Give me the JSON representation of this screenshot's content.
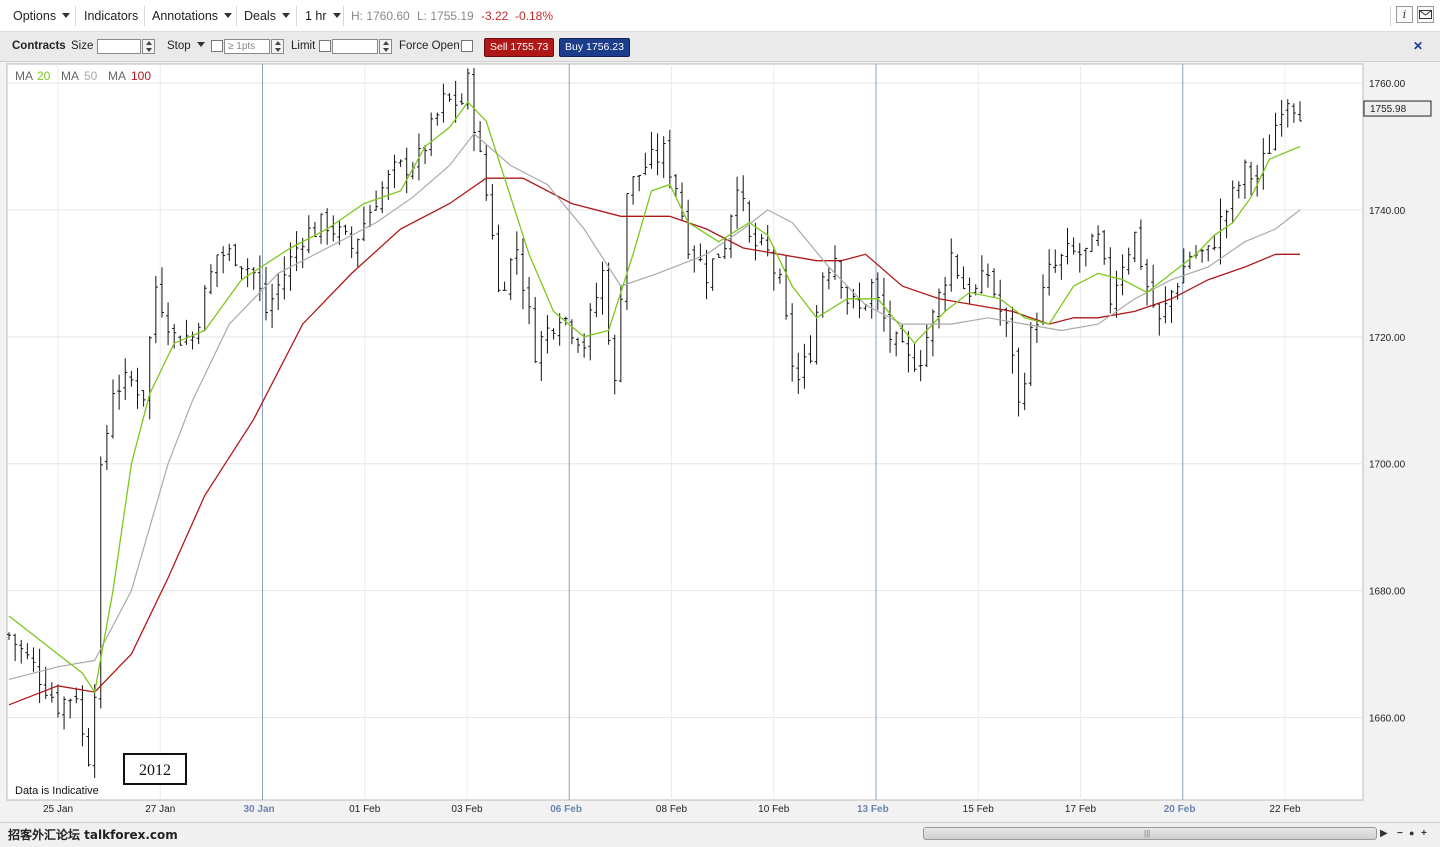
{
  "toolbar": {
    "menus": [
      "Options",
      "Indicators",
      "Annotations",
      "Deals",
      "1 hr"
    ],
    "high": "H: 1760.60",
    "low": "L: 1755.19",
    "change": "-3.22",
    "change_pct": "-0.18%",
    "info_glyph": "i",
    "icons": [
      "info-icon",
      "mail-icon"
    ]
  },
  "trade": {
    "contracts_label": "Contracts",
    "size_label": "Size",
    "size_value": "",
    "stop_label": "Stop",
    "stop_placeholder": "≥ 1pts",
    "limit_label": "Limit",
    "limit_value": "",
    "force_open_label": "Force Open",
    "sell_label": "Sell 1755.73",
    "buy_label": "Buy 1756.23",
    "close_glyph": "✕"
  },
  "legend": [
    {
      "prefix": "MA",
      "period": "20",
      "color": "#7cc81e"
    },
    {
      "prefix": "MA",
      "period": "50",
      "color": "#aaaaaa"
    },
    {
      "prefix": "MA",
      "period": "100",
      "color": "#b01818"
    }
  ],
  "chart_data": {
    "type": "ohlc",
    "y_ticks": [
      1660,
      1680,
      1700,
      1720,
      1740,
      1760
    ],
    "y_tick_labels": [
      "1660.00",
      "1680.00",
      "1700.00",
      "1720.00",
      "1740.00",
      "1760.00"
    ],
    "ylim": [
      1647,
      1763
    ],
    "current_price": 1755.98,
    "current_price_label": "1755.98",
    "x_labels": [
      {
        "text": "25 Jan",
        "week_start": false
      },
      {
        "text": "27 Jan",
        "week_start": false
      },
      {
        "text": "30 Jan",
        "week_start": true
      },
      {
        "text": "01 Feb",
        "week_start": false
      },
      {
        "text": "03 Feb",
        "week_start": false
      },
      {
        "text": "06 Feb",
        "week_start": true
      },
      {
        "text": "08 Feb",
        "week_start": false
      },
      {
        "text": "10 Feb",
        "week_start": false
      },
      {
        "text": "13 Feb",
        "week_start": true
      },
      {
        "text": "15 Feb",
        "week_start": false
      },
      {
        "text": "17 Feb",
        "week_start": false
      },
      {
        "text": "20 Feb",
        "week_start": true
      },
      {
        "text": "22 Feb",
        "week_start": false
      }
    ],
    "price_path": [
      [
        0,
        1673
      ],
      [
        4,
        1668
      ],
      [
        8,
        1662
      ],
      [
        11,
        1664
      ],
      [
        12,
        1657
      ],
      [
        13,
        1654
      ],
      [
        14,
        1665
      ],
      [
        15,
        1698
      ],
      [
        17,
        1712
      ],
      [
        20,
        1713
      ],
      [
        22,
        1711
      ],
      [
        24,
        1728
      ],
      [
        27,
        1720
      ],
      [
        30,
        1720
      ],
      [
        34,
        1733
      ],
      [
        37,
        1733
      ],
      [
        40,
        1730
      ],
      [
        42,
        1724
      ],
      [
        45,
        1730
      ],
      [
        48,
        1736
      ],
      [
        52,
        1738
      ],
      [
        56,
        1734
      ],
      [
        60,
        1742
      ],
      [
        63,
        1746
      ],
      [
        67,
        1748
      ],
      [
        71,
        1757
      ],
      [
        74,
        1757
      ],
      [
        75,
        1760
      ],
      [
        77,
        1748
      ],
      [
        79,
        1737
      ],
      [
        80,
        1727
      ],
      [
        83,
        1734
      ],
      [
        86,
        1718
      ],
      [
        90,
        1724
      ],
      [
        94,
        1719
      ],
      [
        97,
        1730
      ],
      [
        99,
        1712
      ],
      [
        101,
        1743
      ],
      [
        104,
        1747
      ],
      [
        107,
        1749
      ],
      [
        109,
        1744
      ],
      [
        111,
        1735
      ],
      [
        114,
        1730
      ],
      [
        117,
        1735
      ],
      [
        119,
        1745
      ],
      [
        121,
        1735
      ],
      [
        124,
        1733
      ],
      [
        126,
        1728
      ],
      [
        128,
        1716
      ],
      [
        129,
        1713
      ],
      [
        131,
        1718
      ],
      [
        133,
        1730
      ],
      [
        135,
        1733
      ],
      [
        137,
        1726
      ],
      [
        139,
        1724
      ],
      [
        141,
        1728
      ],
      [
        144,
        1720
      ],
      [
        147,
        1716
      ],
      [
        149,
        1717
      ],
      [
        151,
        1723
      ],
      [
        154,
        1733
      ],
      [
        156,
        1728
      ],
      [
        158,
        1727
      ],
      [
        160,
        1730
      ],
      [
        162,
        1724
      ],
      [
        164,
        1718
      ],
      [
        165,
        1709
      ],
      [
        167,
        1720
      ],
      [
        170,
        1730
      ],
      [
        173,
        1733
      ],
      [
        176,
        1733
      ],
      [
        178,
        1735
      ],
      [
        180,
        1726
      ],
      [
        182,
        1732
      ],
      [
        184,
        1736
      ],
      [
        186,
        1728
      ],
      [
        188,
        1722
      ],
      [
        190,
        1727
      ],
      [
        193,
        1733
      ],
      [
        196,
        1733
      ],
      [
        198,
        1738
      ],
      [
        200,
        1742
      ],
      [
        202,
        1746
      ],
      [
        204,
        1745
      ],
      [
        206,
        1750
      ],
      [
        208,
        1757
      ],
      [
        209,
        1758
      ],
      [
        211,
        1755.98
      ]
    ],
    "ma_20": [
      [
        0,
        1676
      ],
      [
        8,
        1670
      ],
      [
        12,
        1667
      ],
      [
        14,
        1664
      ],
      [
        17,
        1680
      ],
      [
        20,
        1700
      ],
      [
        23,
        1711
      ],
      [
        27,
        1719
      ],
      [
        32,
        1721
      ],
      [
        38,
        1729
      ],
      [
        46,
        1734
      ],
      [
        52,
        1737
      ],
      [
        58,
        1741
      ],
      [
        64,
        1743
      ],
      [
        68,
        1750
      ],
      [
        72,
        1753
      ],
      [
        75,
        1757
      ],
      [
        78,
        1754
      ],
      [
        81,
        1745
      ],
      [
        85,
        1733
      ],
      [
        89,
        1724
      ],
      [
        94,
        1720
      ],
      [
        98,
        1721
      ],
      [
        102,
        1733
      ],
      [
        105,
        1743
      ],
      [
        108,
        1744
      ],
      [
        111,
        1738
      ],
      [
        116,
        1735
      ],
      [
        121,
        1738
      ],
      [
        124,
        1736
      ],
      [
        128,
        1728
      ],
      [
        132,
        1723
      ],
      [
        137,
        1726
      ],
      [
        142,
        1726
      ],
      [
        148,
        1719
      ],
      [
        153,
        1724
      ],
      [
        157,
        1727
      ],
      [
        162,
        1726
      ],
      [
        166,
        1723
      ],
      [
        170,
        1722
      ],
      [
        174,
        1728
      ],
      [
        178,
        1730
      ],
      [
        182,
        1729
      ],
      [
        186,
        1727
      ],
      [
        190,
        1730
      ],
      [
        194,
        1733
      ],
      [
        197,
        1736
      ],
      [
        200,
        1738
      ],
      [
        203,
        1742
      ],
      [
        206,
        1748
      ],
      [
        211,
        1750
      ]
    ],
    "ma_50": [
      [
        0,
        1666
      ],
      [
        8,
        1668
      ],
      [
        14,
        1669
      ],
      [
        20,
        1680
      ],
      [
        26,
        1700
      ],
      [
        30,
        1710
      ],
      [
        36,
        1722
      ],
      [
        44,
        1730
      ],
      [
        52,
        1734
      ],
      [
        60,
        1738
      ],
      [
        66,
        1742
      ],
      [
        72,
        1747
      ],
      [
        76,
        1752
      ],
      [
        82,
        1747
      ],
      [
        88,
        1744
      ],
      [
        94,
        1737
      ],
      [
        100,
        1728
      ],
      [
        106,
        1730
      ],
      [
        114,
        1733
      ],
      [
        120,
        1737
      ],
      [
        124,
        1740
      ],
      [
        128,
        1738
      ],
      [
        134,
        1731
      ],
      [
        140,
        1725
      ],
      [
        146,
        1722
      ],
      [
        154,
        1722
      ],
      [
        160,
        1723
      ],
      [
        166,
        1722
      ],
      [
        172,
        1721
      ],
      [
        178,
        1722
      ],
      [
        184,
        1726
      ],
      [
        190,
        1729
      ],
      [
        196,
        1731
      ],
      [
        202,
        1735
      ],
      [
        207,
        1737
      ],
      [
        211,
        1740
      ]
    ],
    "ma_100": [
      [
        0,
        1662
      ],
      [
        8,
        1665
      ],
      [
        14,
        1664
      ],
      [
        20,
        1670
      ],
      [
        26,
        1682
      ],
      [
        32,
        1695
      ],
      [
        40,
        1707
      ],
      [
        48,
        1722
      ],
      [
        56,
        1730
      ],
      [
        64,
        1737
      ],
      [
        72,
        1741
      ],
      [
        78,
        1745
      ],
      [
        84,
        1745
      ],
      [
        92,
        1741
      ],
      [
        100,
        1739
      ],
      [
        108,
        1739
      ],
      [
        114,
        1737
      ],
      [
        120,
        1734
      ],
      [
        126,
        1733
      ],
      [
        132,
        1732
      ],
      [
        136,
        1732
      ],
      [
        140,
        1733
      ],
      [
        146,
        1728
      ],
      [
        152,
        1726
      ],
      [
        158,
        1725
      ],
      [
        164,
        1724
      ],
      [
        170,
        1722
      ],
      [
        174,
        1723
      ],
      [
        178,
        1723
      ],
      [
        184,
        1724
      ],
      [
        190,
        1726
      ],
      [
        196,
        1729
      ],
      [
        202,
        1731
      ],
      [
        207,
        1733
      ],
      [
        211,
        1733
      ]
    ]
  },
  "annotations": {
    "year_box": "2012",
    "indicative": "Data is Indicative"
  },
  "footer": {
    "watermark": "招客外汇论坛 talkforex.com",
    "grip": "|||",
    "arrow_right": "▶",
    "arrow_left": "−",
    "arrow_fwd": "●",
    "arrow_plus": "+"
  }
}
